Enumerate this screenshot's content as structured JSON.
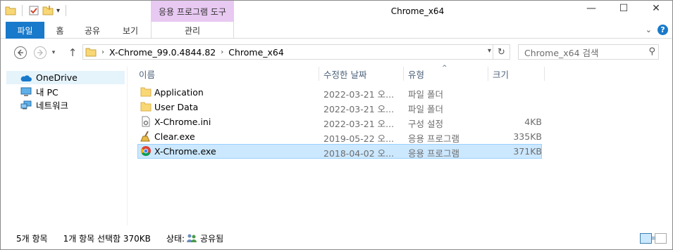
{
  "window": {
    "title": "Chrome_x64",
    "minimize": "—",
    "maximize": "☐",
    "close": "✕"
  },
  "ribbon": {
    "context_group": "응용 프로그램 도구",
    "tabs": [
      {
        "label": "파일"
      },
      {
        "label": "홈"
      },
      {
        "label": "공유"
      },
      {
        "label": "보기"
      }
    ],
    "context_tab": "관리",
    "help": "?"
  },
  "address": {
    "breadcrumb": [
      "X-Chrome_99.0.4844.82",
      "Chrome_x64"
    ]
  },
  "search": {
    "placeholder": "Chrome_x64 검색"
  },
  "nav": {
    "items": [
      {
        "label": "OneDrive",
        "icon": "cloud-icon",
        "selected": true
      },
      {
        "label": "내 PC",
        "icon": "computer-icon",
        "selected": false
      },
      {
        "label": "네트워크",
        "icon": "network-icon",
        "selected": false
      }
    ]
  },
  "columns": {
    "name": "이름",
    "modified": "수정한 날짜",
    "type": "유형",
    "size": "크기"
  },
  "files": [
    {
      "name": "Application",
      "modified": "2022-03-21 오...",
      "type": "파일 폴더",
      "size": "",
      "icon": "folder-icon",
      "selected": false
    },
    {
      "name": "User Data",
      "modified": "2022-03-21 오...",
      "type": "파일 폴더",
      "size": "",
      "icon": "folder-icon",
      "selected": false
    },
    {
      "name": "X-Chrome.ini",
      "modified": "2022-03-21 오...",
      "type": "구성 설정",
      "size": "4KB",
      "icon": "settings-file-icon",
      "selected": false
    },
    {
      "name": "Clear.exe",
      "modified": "2019-05-22 오...",
      "type": "응용 프로그램",
      "size": "335KB",
      "icon": "broom-icon",
      "selected": false
    },
    {
      "name": "X-Chrome.exe",
      "modified": "2018-04-02 오...",
      "type": "응용 프로그램",
      "size": "371KB",
      "icon": "chrome-icon",
      "selected": true
    }
  ],
  "status": {
    "count": "5개 항목",
    "selection": "1개 항목 선택함 370KB",
    "state_label": "상태:",
    "state_value": "공유됨"
  },
  "colors": {
    "accent": "#1979ca",
    "selection": "#cce8ff",
    "context": "#e8c9f2"
  }
}
